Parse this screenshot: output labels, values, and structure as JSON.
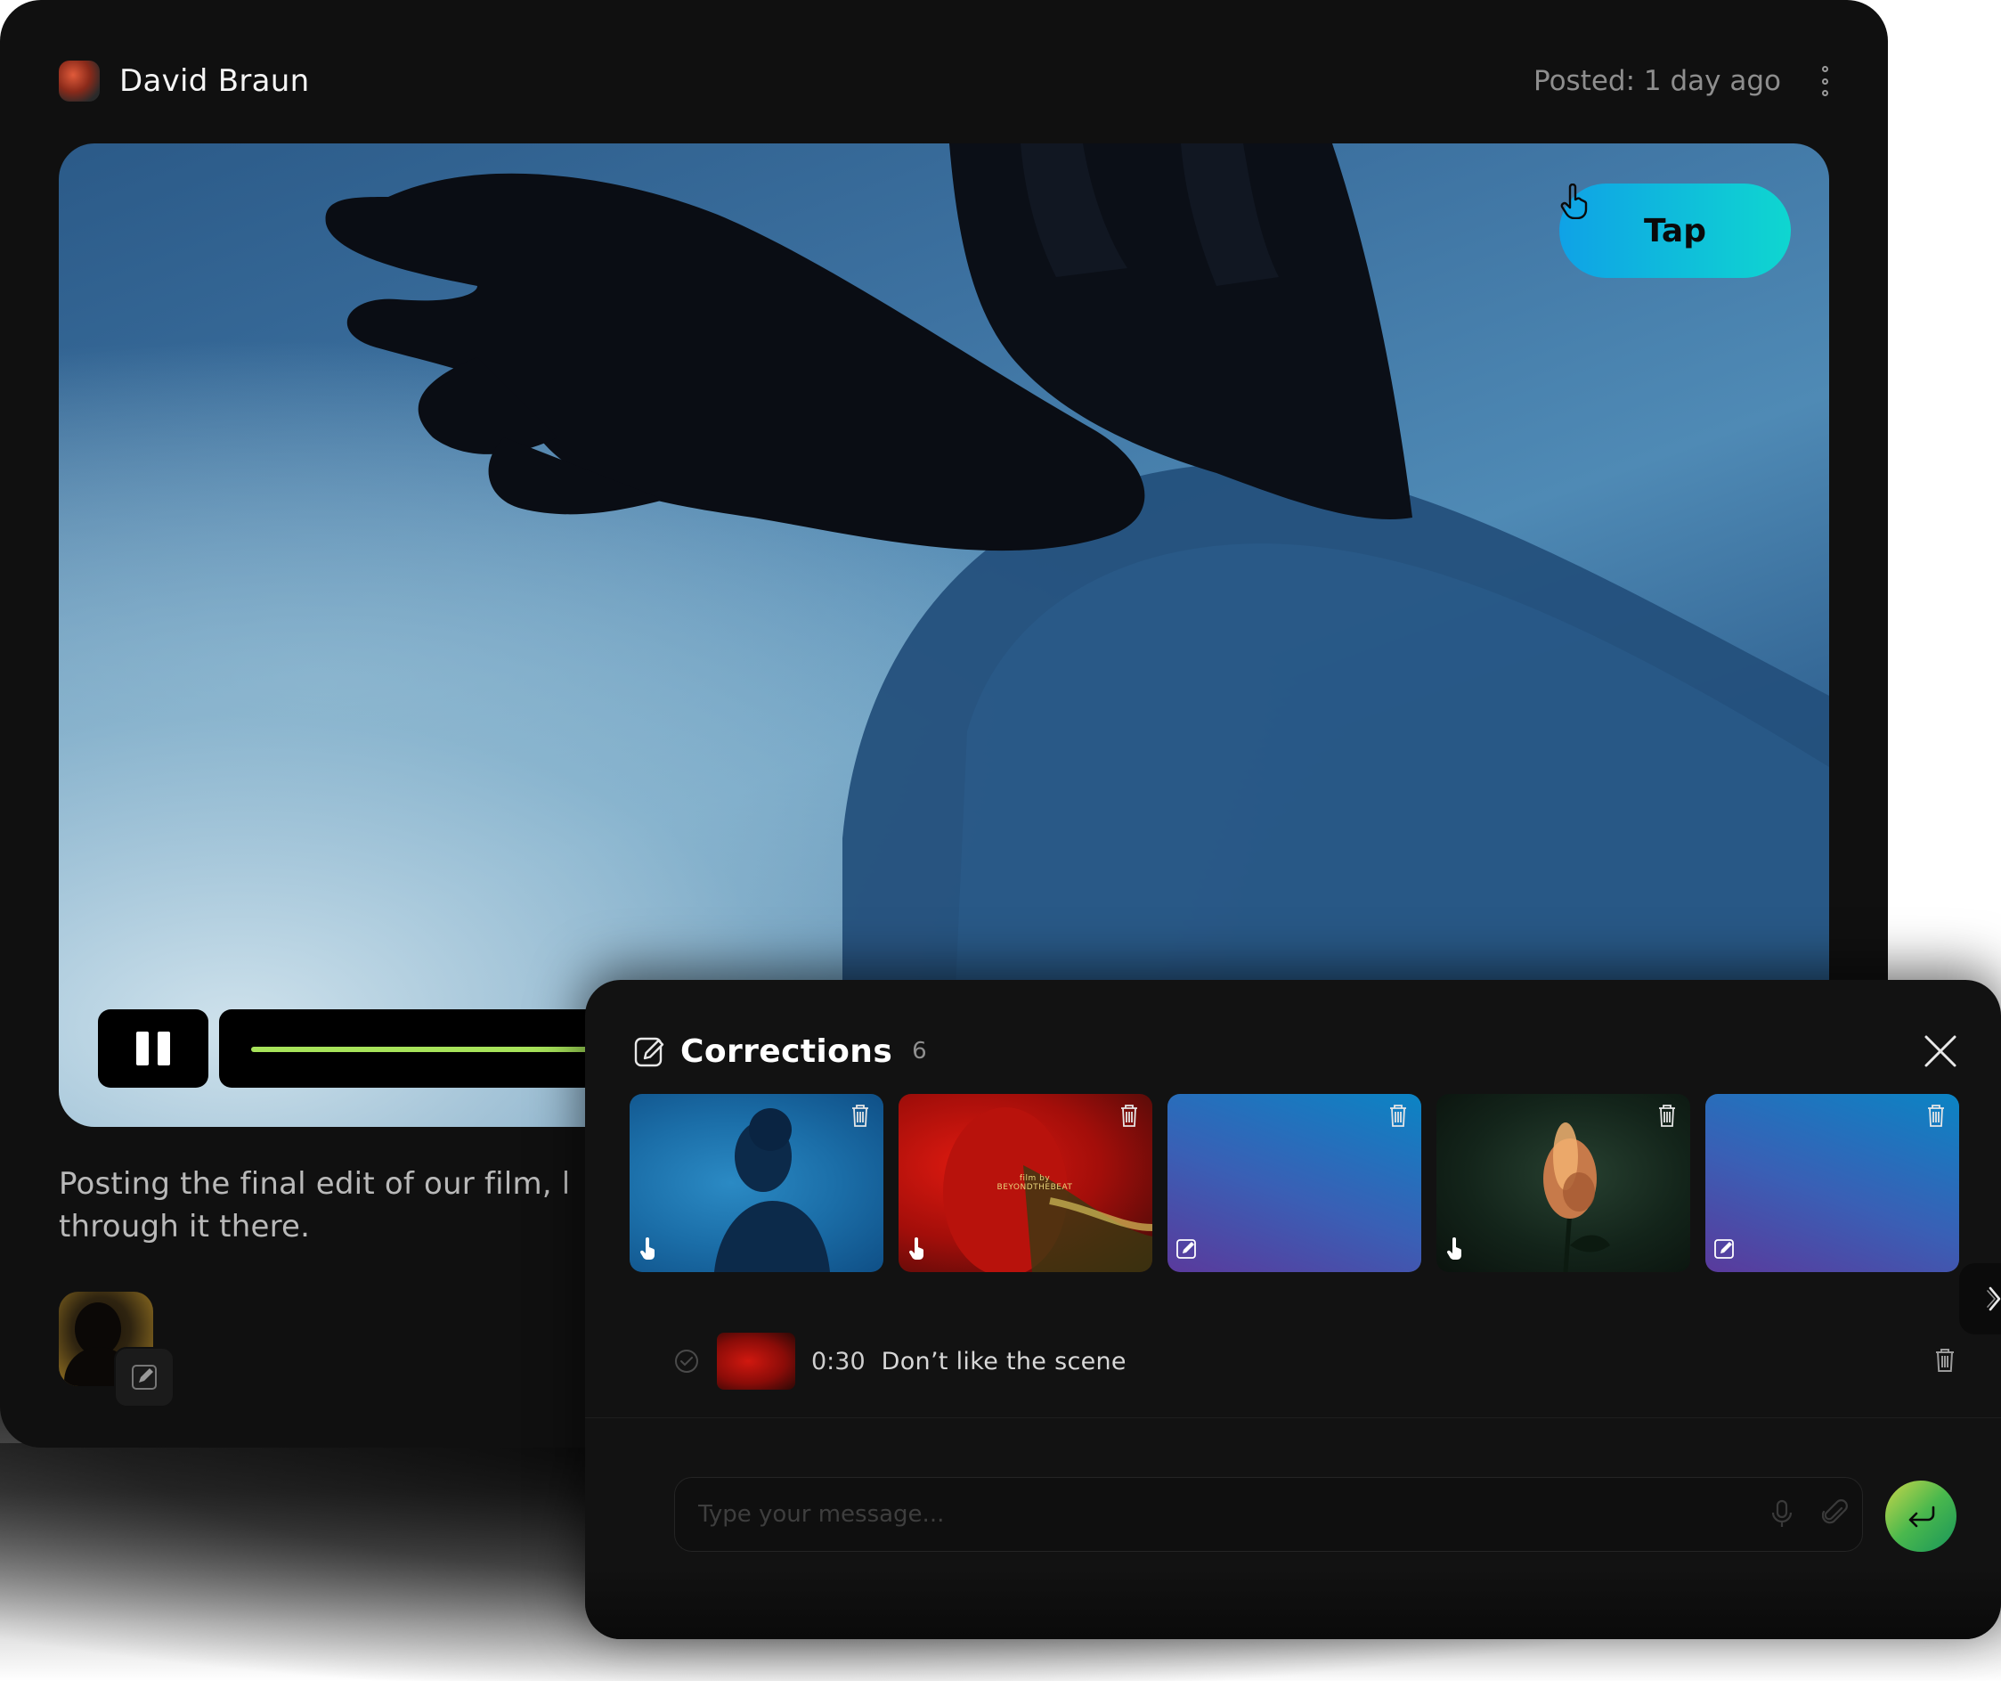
{
  "post": {
    "author": "David Braun",
    "posted": "Posted: 1 day ago",
    "tap_label": "Tap",
    "caption_line1": "Posting the final edit of our film, l",
    "caption_line2": "through it there.",
    "progress": 0.66
  },
  "corrections": {
    "title": "Corrections",
    "count": "6",
    "thumbnails": [
      {
        "kind": "tap-icon",
        "overlay_text": ""
      },
      {
        "kind": "tap-icon",
        "overlay_text": "film by BEYONDTHEBEAT"
      },
      {
        "kind": "pencil-icon",
        "overlay_text": ""
      },
      {
        "kind": "tap-icon",
        "overlay_text": ""
      },
      {
        "kind": "pencil-icon",
        "overlay_text": ""
      }
    ],
    "row": {
      "time": "0:30",
      "text": "Don’t like the scene"
    },
    "composer": {
      "placeholder": "Type your message..."
    }
  },
  "colors": {
    "accent_green": "#a7e35a",
    "tap_gradient_start": "#0fa2e6",
    "tap_gradient_end": "#0fd6d0",
    "panel_bg": "#121212"
  }
}
